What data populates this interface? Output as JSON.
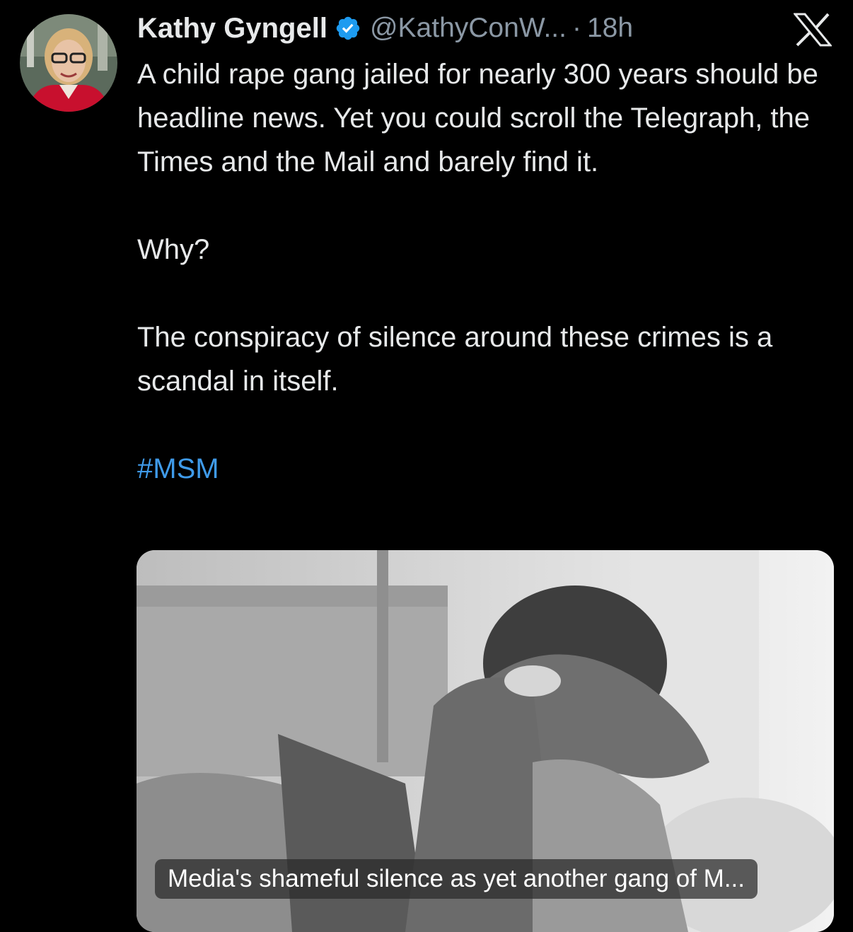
{
  "author": {
    "name": "Kathy Gyngell",
    "handle": "@KathyConW...",
    "separator": "·",
    "time": "18h",
    "verified": true,
    "avatar_icon": "profile-photo"
  },
  "platform_logo": "x-logo-icon",
  "tweet": {
    "paragraph1": "A child rape gang jailed for nearly 300 years should be headline news. Yet you could scroll the Telegraph, the Times and the Mail and barely find it.",
    "paragraph2": "Why?",
    "paragraph3": "The conspiracy of silence around these crimes is a scandal in itself.",
    "hashtag": "#MSM"
  },
  "link_card": {
    "title": "Media's shameful silence as yet another gang of M..."
  },
  "colors": {
    "background": "#000000",
    "text": "#e7e9ea",
    "secondary": "#8b98a5",
    "link": "#3f9bea",
    "verified_badge": "#1d9bf0"
  }
}
